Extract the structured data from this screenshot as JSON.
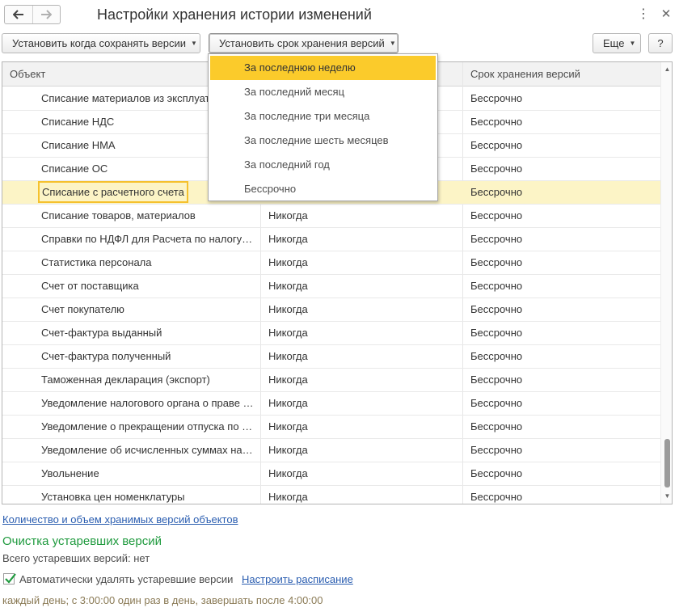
{
  "window": {
    "title": "Настройки хранения истории изменений"
  },
  "toolbar": {
    "when_save_label": "Установить когда сохранять версии",
    "retention_label": "Установить срок хранения версий",
    "more_label": "Еще",
    "help_label": "?"
  },
  "table": {
    "columns": [
      "Объект",
      "",
      "Срок хранения версий"
    ],
    "rows": [
      {
        "object": "Списание материалов из эксплуатации",
        "when": "",
        "retention": "Бессрочно"
      },
      {
        "object": "Списание НДС",
        "when": "",
        "retention": "Бессрочно"
      },
      {
        "object": "Списание НМА",
        "when": "",
        "retention": "Бессрочно"
      },
      {
        "object": "Списание ОС",
        "when": "",
        "retention": "Бессрочно"
      },
      {
        "object": "Списание с расчетного счета",
        "when": "",
        "retention": "Бессрочно"
      },
      {
        "object": "Списание товаров, материалов",
        "when": "Никогда",
        "retention": "Бессрочно"
      },
      {
        "object": "Справки по НДФЛ для Расчета по налогу…",
        "when": "Никогда",
        "retention": "Бессрочно"
      },
      {
        "object": "Статистика персонала",
        "when": "Никогда",
        "retention": "Бессрочно"
      },
      {
        "object": "Счет от поставщика",
        "when": "Никогда",
        "retention": "Бессрочно"
      },
      {
        "object": "Счет покупателю",
        "when": "Никогда",
        "retention": "Бессрочно"
      },
      {
        "object": "Счет-фактура выданный",
        "when": "Никогда",
        "retention": "Бессрочно"
      },
      {
        "object": "Счет-фактура полученный",
        "when": "Никогда",
        "retention": "Бессрочно"
      },
      {
        "object": "Таможенная декларация (экспорт)",
        "when": "Никогда",
        "retention": "Бессрочно"
      },
      {
        "object": "Уведомление налогового органа о праве …",
        "when": "Никогда",
        "retention": "Бессрочно"
      },
      {
        "object": "Уведомление о прекращении отпуска по …",
        "when": "Никогда",
        "retention": "Бессрочно"
      },
      {
        "object": "Уведомление об исчисленных суммах на…",
        "when": "Никогда",
        "retention": "Бессрочно"
      },
      {
        "object": "Увольнение",
        "when": "Никогда",
        "retention": "Бессрочно"
      },
      {
        "object": "Установка цен номенклатуры",
        "when": "Никогда",
        "retention": "Бессрочно"
      }
    ]
  },
  "dropdown": {
    "items": [
      "За последнюю неделю",
      "За последний месяц",
      "За последние три месяца",
      "За последние шесть месяцев",
      "За последний год",
      "Бессрочно"
    ]
  },
  "footer": {
    "stats_link": "Количество и объем хранимых версий объектов",
    "cleanup_heading": "Очистка устаревших версий",
    "obsolete_count": "Всего устаревших версий: нет",
    "auto_delete_label": "Автоматически удалять устаревшие версии",
    "schedule_link": "Настроить расписание",
    "schedule_text": "каждый день; с 3:00:00 один раз в день, завершать после 4:00:00"
  },
  "colors": {
    "highlight": "#fbcb2b",
    "selected_row": "#fcf4c6",
    "link": "#2a5db0",
    "heading_green": "#1f9a3e"
  }
}
